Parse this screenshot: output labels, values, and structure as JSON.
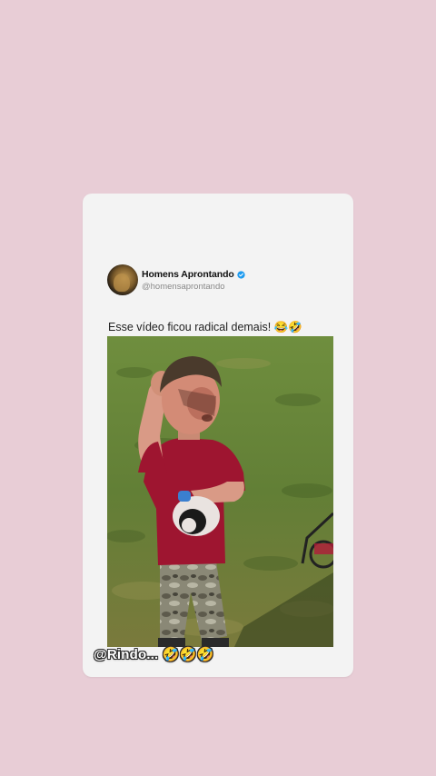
{
  "post": {
    "author": {
      "display_name": "Homens Aprontando",
      "handle": "@homensaprontando",
      "verified": true
    },
    "caption": "Esse vídeo ficou radical demais! 😂🤣",
    "media": {
      "type": "video-frame"
    }
  },
  "overlay": {
    "text": "@Rindo... 🤣🤣🤣"
  },
  "colors": {
    "background": "#e8cdd6",
    "card": "#f3f3f3",
    "verified_badge": "#1d9bf0"
  },
  "icons": {
    "verified": "verified-badge-icon"
  }
}
